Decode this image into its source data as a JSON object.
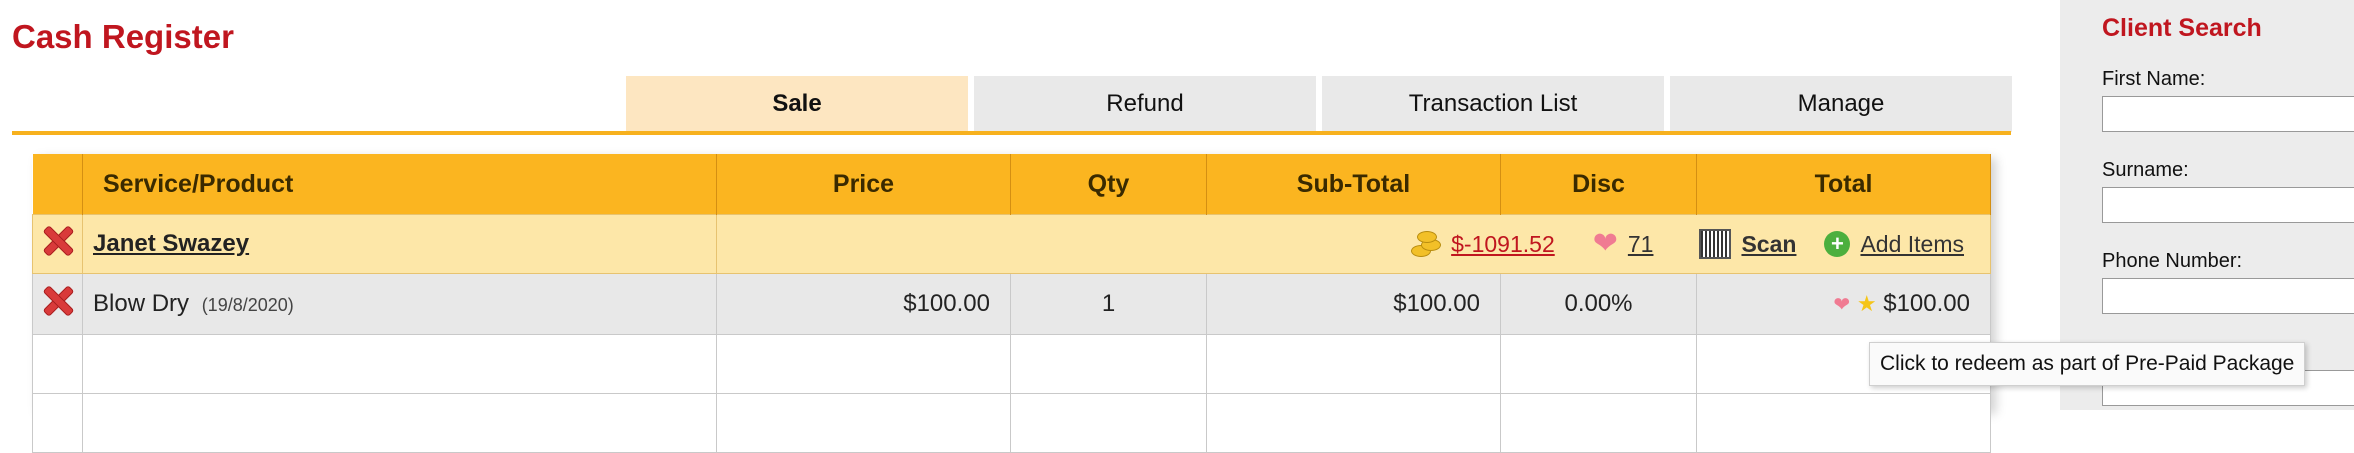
{
  "page": {
    "title": "Cash Register"
  },
  "tabs": [
    {
      "label": "Sale",
      "active": true
    },
    {
      "label": "Refund",
      "active": false
    },
    {
      "label": "Transaction List",
      "active": false
    },
    {
      "label": "Manage",
      "active": false
    }
  ],
  "table": {
    "headers": [
      "",
      "Service/Product",
      "Price",
      "Qty",
      "Sub-Total",
      "Disc",
      "Total"
    ],
    "client": {
      "name": "Janet Swazey",
      "account_balance": "$-1091.52",
      "loyalty_points": "71",
      "scan_label": "Scan",
      "add_items_label": "Add Items"
    },
    "items": [
      {
        "name": "Blow Dry",
        "date": "(19/8/2020)",
        "price": "$100.00",
        "qty": "1",
        "subtotal": "$100.00",
        "disc": "0.00%",
        "total": "$100.00"
      }
    ]
  },
  "tooltip": {
    "text": "Click to redeem as part of Pre-Paid Package"
  },
  "client_search": {
    "title": "Client Search",
    "first_name_label": "First Name:",
    "surname_label": "Surname:",
    "phone_label": "Phone Number:"
  },
  "colors": {
    "brand_red": "#c0161f",
    "header_orange": "#fbb520",
    "active_tab": "#fde6c1",
    "client_row": "#fde7a8"
  },
  "icons": [
    "remove-icon",
    "coins-icon",
    "heart-icon",
    "barcode-icon",
    "add-circle-icon",
    "star-icon"
  ]
}
